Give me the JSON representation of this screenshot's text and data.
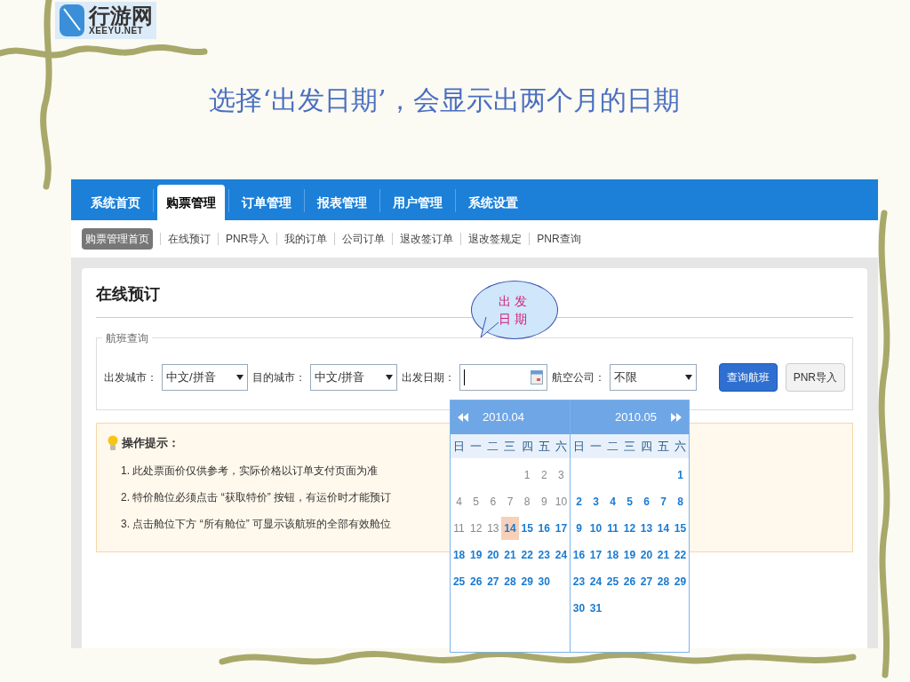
{
  "logo": {
    "name": "行游网",
    "domain": "XEEYU.NET"
  },
  "slide_title": "选择‘出发日期’，会显示出两个月的日期",
  "nav_tabs": [
    {
      "label": "系统首页",
      "selected": false
    },
    {
      "label": "购票管理",
      "selected": true
    },
    {
      "label": "订单管理",
      "selected": false
    },
    {
      "label": "报表管理",
      "selected": false
    },
    {
      "label": "用户管理",
      "selected": false
    },
    {
      "label": "系统设置",
      "selected": false
    }
  ],
  "sub_nav": [
    {
      "label": "购票管理首页",
      "selected": true
    },
    {
      "label": "在线预订",
      "selected": false
    },
    {
      "label": "PNR导入",
      "selected": false
    },
    {
      "label": "我的订单",
      "selected": false
    },
    {
      "label": "公司订单",
      "selected": false
    },
    {
      "label": "退改签订单",
      "selected": false
    },
    {
      "label": "退改签规定",
      "selected": false
    },
    {
      "label": "PNR查询",
      "selected": false
    }
  ],
  "page_title": "在线预订",
  "callout": "出发日期",
  "search_panel": {
    "legend": "航班查询",
    "fields": [
      {
        "kind": "select",
        "label": "出发城市：",
        "value": "中文/拼音"
      },
      {
        "kind": "select",
        "label": "目的城市：",
        "value": "中文/拼音"
      },
      {
        "kind": "date",
        "label": "出发日期："
      },
      {
        "kind": "select",
        "label": "航空公司：",
        "value": "不限"
      }
    ],
    "buttons": [
      {
        "label": "查询航班",
        "kind": "primary"
      },
      {
        "label": "PNR导入",
        "kind": "secondary"
      }
    ]
  },
  "tips": {
    "title": "操作提示：",
    "items": [
      "1. 此处票面价仅供参考，实际价格以订单支付页面为准",
      "2. 特价舱位必须点击 “获取特价” 按钮，有运价时才能预订",
      "3. 点击舱位下方 “所有舱位” 可显示该航班的全部有效舱位"
    ]
  },
  "calendar": {
    "months": [
      {
        "title": "2010.04",
        "kind": "prev",
        "weekdays": [
          "日",
          "一",
          "二",
          "三",
          "四",
          "五",
          "六"
        ],
        "days": [
          {
            "kind": "blank"
          },
          {
            "kind": "blank"
          },
          {
            "kind": "blank"
          },
          {
            "kind": "blank"
          },
          {
            "day": "1",
            "kind": "past"
          },
          {
            "day": "2",
            "kind": "past"
          },
          {
            "day": "3",
            "kind": "past"
          },
          {
            "day": "4",
            "kind": "past"
          },
          {
            "day": "5",
            "kind": "past"
          },
          {
            "day": "6",
            "kind": "past"
          },
          {
            "day": "7",
            "kind": "past"
          },
          {
            "day": "8",
            "kind": "past"
          },
          {
            "day": "9",
            "kind": "past"
          },
          {
            "day": "10",
            "kind": "past"
          },
          {
            "day": "11",
            "kind": "past"
          },
          {
            "day": "12",
            "kind": "past"
          },
          {
            "day": "13",
            "kind": "past"
          },
          {
            "day": "14",
            "kind": "today"
          },
          {
            "day": "15",
            "kind": "open"
          },
          {
            "day": "16",
            "kind": "open"
          },
          {
            "day": "17",
            "kind": "open"
          },
          {
            "day": "18",
            "kind": "open"
          },
          {
            "day": "19",
            "kind": "open"
          },
          {
            "day": "20",
            "kind": "open"
          },
          {
            "day": "21",
            "kind": "open"
          },
          {
            "day": "22",
            "kind": "open"
          },
          {
            "day": "23",
            "kind": "open"
          },
          {
            "day": "24",
            "kind": "open"
          },
          {
            "day": "25",
            "kind": "open"
          },
          {
            "day": "26",
            "kind": "open"
          },
          {
            "day": "27",
            "kind": "open"
          },
          {
            "day": "28",
            "kind": "open"
          },
          {
            "day": "29",
            "kind": "open"
          },
          {
            "day": "30",
            "kind": "open"
          }
        ]
      },
      {
        "title": "2010.05",
        "kind": "next",
        "weekdays": [
          "日",
          "一",
          "二",
          "三",
          "四",
          "五",
          "六"
        ],
        "days": [
          {
            "kind": "blank"
          },
          {
            "kind": "blank"
          },
          {
            "kind": "blank"
          },
          {
            "kind": "blank"
          },
          {
            "kind": "blank"
          },
          {
            "kind": "blank"
          },
          {
            "day": "1",
            "kind": "open"
          },
          {
            "day": "2",
            "kind": "open"
          },
          {
            "day": "3",
            "kind": "open"
          },
          {
            "day": "4",
            "kind": "open"
          },
          {
            "day": "5",
            "kind": "open"
          },
          {
            "day": "6",
            "kind": "open"
          },
          {
            "day": "7",
            "kind": "open"
          },
          {
            "day": "8",
            "kind": "open"
          },
          {
            "day": "9",
            "kind": "open"
          },
          {
            "day": "10",
            "kind": "open"
          },
          {
            "day": "11",
            "kind": "open"
          },
          {
            "day": "12",
            "kind": "open"
          },
          {
            "day": "13",
            "kind": "open"
          },
          {
            "day": "14",
            "kind": "open"
          },
          {
            "day": "15",
            "kind": "open"
          },
          {
            "day": "16",
            "kind": "open"
          },
          {
            "day": "17",
            "kind": "open"
          },
          {
            "day": "18",
            "kind": "open"
          },
          {
            "day": "19",
            "kind": "open"
          },
          {
            "day": "20",
            "kind": "open"
          },
          {
            "day": "21",
            "kind": "open"
          },
          {
            "day": "22",
            "kind": "open"
          },
          {
            "day": "23",
            "kind": "open"
          },
          {
            "day": "24",
            "kind": "open"
          },
          {
            "day": "25",
            "kind": "open"
          },
          {
            "day": "26",
            "kind": "open"
          },
          {
            "day": "27",
            "kind": "open"
          },
          {
            "day": "28",
            "kind": "open"
          },
          {
            "day": "29",
            "kind": "open"
          },
          {
            "day": "30",
            "kind": "open"
          },
          {
            "day": "31",
            "kind": "open"
          }
        ]
      }
    ]
  }
}
